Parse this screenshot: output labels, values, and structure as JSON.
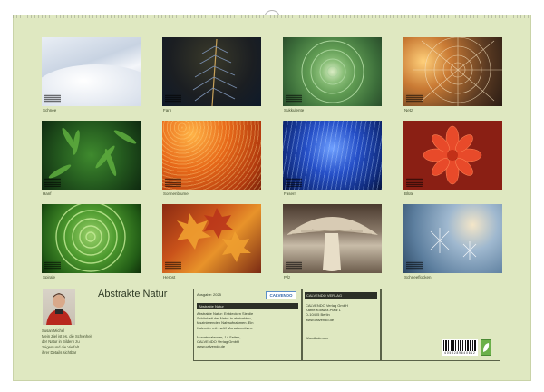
{
  "page": {
    "title": "Abstrakte Natur"
  },
  "months": [
    {
      "label": "Schnee",
      "icon": "snow-dunes-photo"
    },
    {
      "label": "Farn",
      "icon": "fern-photo"
    },
    {
      "label": "Sukkulente",
      "icon": "succulent-photo"
    },
    {
      "label": "Netz",
      "icon": "spider-web-photo"
    },
    {
      "label": "Hanf",
      "icon": "hemp-leaves-photo"
    },
    {
      "label": "Sonnenblume",
      "icon": "sunflower-photo"
    },
    {
      "label": "Fasern",
      "icon": "blue-fibers-photo"
    },
    {
      "label": "Blüte",
      "icon": "dahlia-photo"
    },
    {
      "label": "Spirale",
      "icon": "fern-spiral-photo"
    },
    {
      "label": "Herbst",
      "icon": "autumn-leaves-photo"
    },
    {
      "label": "Pilz",
      "icon": "mushroom-photo"
    },
    {
      "label": "Schneeflocken",
      "icon": "snowflakes-photo"
    }
  ],
  "author": {
    "name": "Susan Michel",
    "bio": [
      "Mein Ziel ist es, die Schönheit",
      "der Natur in Bildern zu",
      "zeigen und die Vielfalt",
      "ihrer Details sichtbar"
    ]
  },
  "panel": {
    "edition_label": "Ausgabe: 2025",
    "calvendo": "CALVENDO",
    "product_title": "Abstrakte Natur",
    "description": [
      "Abstrakte Natur: Entdecken Sie die",
      "Schönheit der Natur in abstrakten,",
      "faszinierenden Nahaufnahmen. Ein",
      "Kalender mit zwölf Monatsmotiven.",
      "",
      "Monatskalender, 14 Seiten,",
      "CALVENDO Verlag GmbH",
      "www.calvendo.de"
    ],
    "publisher_head": "CALVENDO VERLAG",
    "publisher": [
      "CALVENDO Verlag GmbH",
      "Käthe-Kollwitz-Platz 1",
      "D-10405 Berlin",
      "www.calvendo.de"
    ],
    "format": "Wandkalender",
    "barcode_number": "4 0 5 8 2 8 9 6 4 0 6 1 2"
  },
  "colors": {
    "sheet": "#dfe8c1",
    "border": "#5a6248",
    "text": "#2f3a25"
  }
}
